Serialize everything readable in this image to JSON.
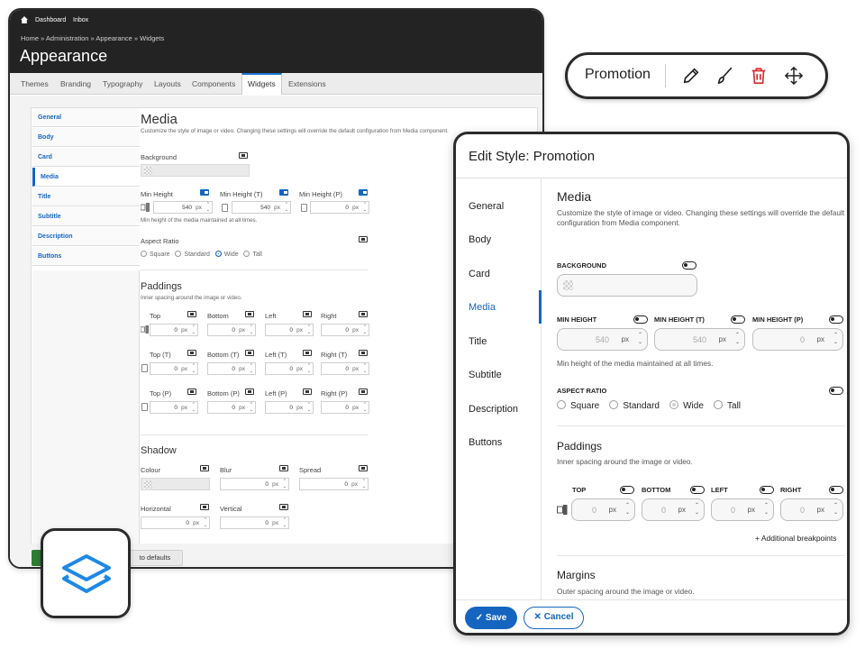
{
  "admin": {
    "topbar": {
      "dashboard": "Dashboard",
      "inbox": "Inbox"
    },
    "breadcrumb": "Home » Administration » Appearance » Widgets",
    "title": "Appearance",
    "tabs": [
      "Themes",
      "Branding",
      "Typography",
      "Layouts",
      "Components",
      "Widgets",
      "Extensions"
    ],
    "active_tab": "Widgets",
    "nav": [
      "General",
      "Body",
      "Card",
      "Media",
      "Title",
      "Subtitle",
      "Description",
      "Buttons"
    ],
    "active_nav": "Media",
    "media": {
      "heading": "Media",
      "description": "Customize the style of image or video. Changing these settings will override the default configuration from Media component.",
      "background_label": "Background",
      "min_height": {
        "desktop_label": "Min Height",
        "tablet_label": "Min Height (T)",
        "phone_label": "Min Height (P)",
        "desktop_value": "540",
        "tablet_value": "540",
        "phone_value": "0",
        "unit": "px",
        "help": "Min height of the media maintained at all times."
      },
      "aspect_ratio": {
        "label": "Aspect Ratio",
        "options": [
          "Square",
          "Standard",
          "Wide",
          "Tall"
        ],
        "selected": "Wide"
      },
      "paddings": {
        "heading": "Paddings",
        "description": "Inner spacing around the image or video.",
        "rows": [
          {
            "labels": [
              "Top",
              "Bottom",
              "Left",
              "Right"
            ]
          },
          {
            "labels": [
              "Top (T)",
              "Bottom (T)",
              "Left (T)",
              "Right (T)"
            ]
          },
          {
            "labels": [
              "Top (P)",
              "Bottom (P)",
              "Left (P)",
              "Right (P)"
            ]
          }
        ],
        "value": "0",
        "unit": "px"
      },
      "shadow": {
        "heading": "Shadow",
        "colour_label": "Colour",
        "blur_label": "Blur",
        "spread_label": "Spread",
        "horizontal_label": "Horizontal",
        "vertical_label": "Vertical",
        "value": "0",
        "unit": "px"
      }
    },
    "footer": {
      "reset_label": "to defaults"
    }
  },
  "toolbar": {
    "label": "Promotion",
    "icons": [
      "pencil-icon",
      "brush-icon",
      "trash-icon",
      "move-icon"
    ],
    "trash_color": "#d32f2f"
  },
  "dialog": {
    "title": "Edit Style: Promotion",
    "nav": [
      "General",
      "Body",
      "Card",
      "Media",
      "Title",
      "Subtitle",
      "Description",
      "Buttons"
    ],
    "active_nav": "Media",
    "media": {
      "heading": "Media",
      "description": "Customize the style of image or video. Changing these settings will override the default configuration from Media component.",
      "background_label": "BACKGROUND",
      "min_height": {
        "desktop_label": "MIN HEIGHT",
        "tablet_label": "MIN HEIGHT (T)",
        "phone_label": "MIN HEIGHT (P)",
        "desktop_value": "540",
        "tablet_value": "540",
        "phone_value": "0",
        "unit": "px",
        "help": "Min height of the media maintained at all times."
      },
      "aspect_ratio": {
        "label": "ASPECT RATIO",
        "options": [
          "Square",
          "Standard",
          "Wide",
          "Tall"
        ],
        "selected": "Wide"
      }
    },
    "paddings": {
      "heading": "Paddings",
      "description": "Inner spacing around the image or video.",
      "labels": [
        "TOP",
        "BOTTOM",
        "LEFT",
        "RIGHT"
      ],
      "value": "0",
      "unit": "px",
      "additional": "+ Additional breakpoints"
    },
    "margins": {
      "heading": "Margins",
      "description": "Outer spacing around the image or video."
    },
    "footer": {
      "save": "Save",
      "cancel": "Cancel"
    }
  },
  "colors": {
    "accent": "#1565c0",
    "dark": "#232323",
    "save_green": "#2e7d32"
  }
}
